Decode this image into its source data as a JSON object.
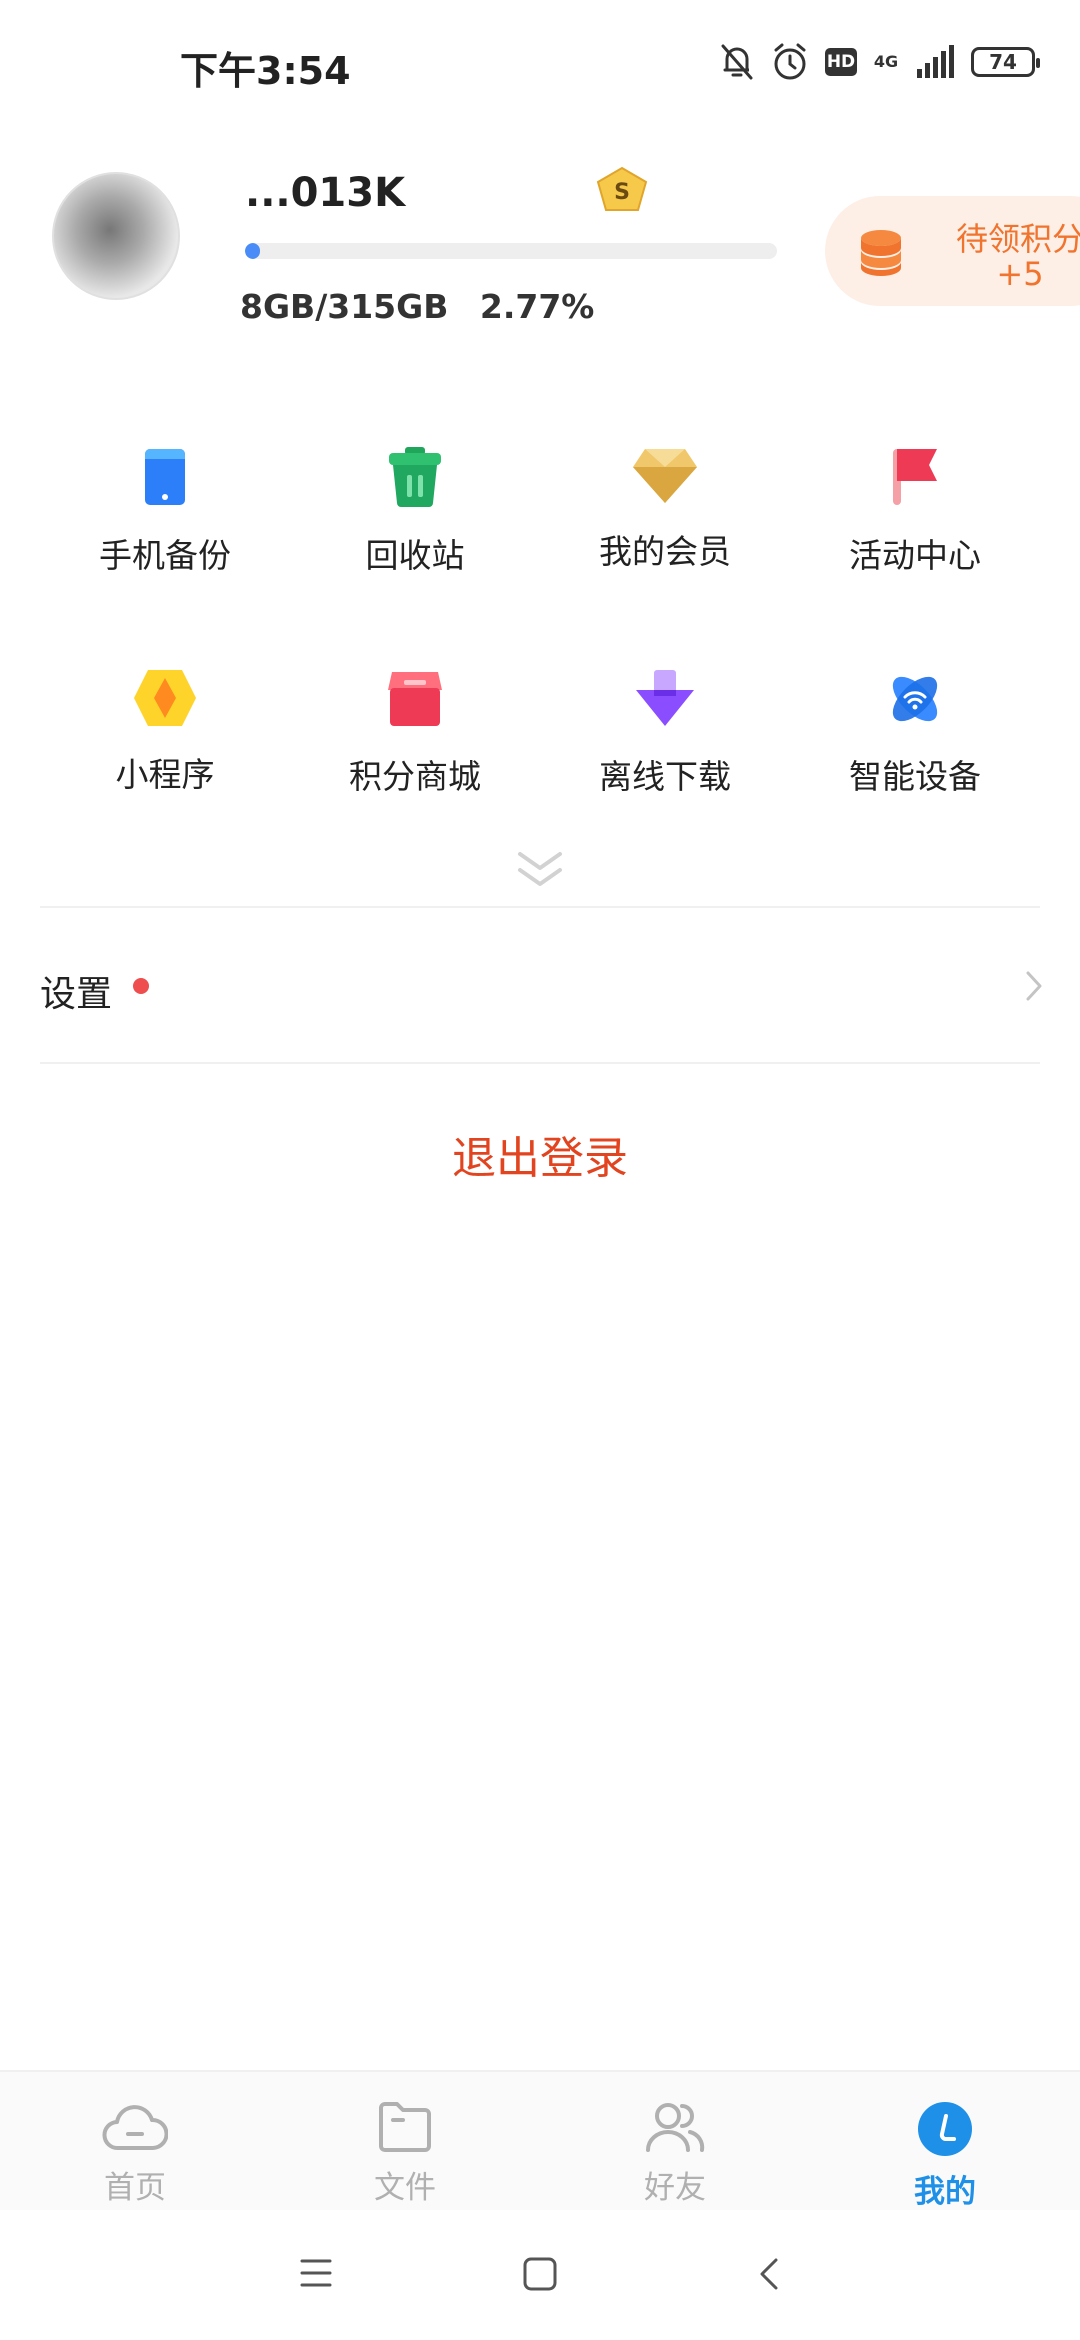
{
  "status_bar": {
    "time": "下午3:54",
    "network_label": "4G",
    "battery_level": "74"
  },
  "profile": {
    "username": "...013K",
    "storage_text": "8GB/315GB 2.77%",
    "storage_used_fraction": 0.0277,
    "points_label": "待领积分",
    "points_value": "+5"
  },
  "grid": {
    "items": [
      {
        "label": "手机备份",
        "icon": "phone-backup-icon"
      },
      {
        "label": "回收站",
        "icon": "recycle-bin-icon"
      },
      {
        "label": "我的会员",
        "icon": "diamond-icon"
      },
      {
        "label": "活动中心",
        "icon": "flag-icon"
      },
      {
        "label": "小程序",
        "icon": "mini-program-icon"
      },
      {
        "label": "积分商城",
        "icon": "store-icon"
      },
      {
        "label": "离线下载",
        "icon": "download-icon"
      },
      {
        "label": "智能设备",
        "icon": "smart-device-icon"
      }
    ]
  },
  "settings": {
    "label": "设置"
  },
  "logout": {
    "label": "退出登录"
  },
  "bottom_nav": {
    "items": [
      {
        "label": "首页",
        "icon": "cloud-home-icon"
      },
      {
        "label": "文件",
        "icon": "folder-icon"
      },
      {
        "label": "好友",
        "icon": "friends-icon"
      },
      {
        "label": "我的",
        "icon": "profile-icon",
        "active": true
      }
    ]
  },
  "colors": {
    "accent_blue": "#1e90e8",
    "logout_red": "#e2441f",
    "points_orange": "#f0742d"
  }
}
